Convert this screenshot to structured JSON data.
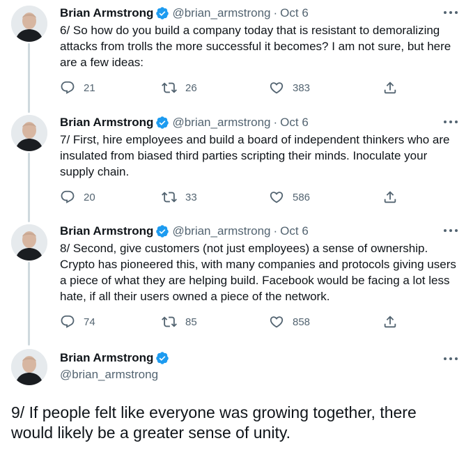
{
  "colors": {
    "verified": "#1d9bf0",
    "secondary_text": "#536471",
    "connector": "#cfd9de"
  },
  "tweets": [
    {
      "name": "Brian Armstrong",
      "handle": "@brian_armstrong",
      "separator": "·",
      "date": "Oct 6",
      "text": "6/ So how do you build a company today that is resistant to demoralizing attacks from trolls the more successful it becomes? I am not sure, but here are a few ideas:",
      "replies": "21",
      "retweets": "26",
      "likes": "383"
    },
    {
      "name": "Brian Armstrong",
      "handle": "@brian_armstrong",
      "separator": "·",
      "date": "Oct 6",
      "text": "7/ First, hire employees and build a board of independent thinkers who are insulated from biased third parties scripting their minds. Inoculate your supply chain.",
      "replies": "20",
      "retweets": "33",
      "likes": "586"
    },
    {
      "name": "Brian Armstrong",
      "handle": "@brian_armstrong",
      "separator": "·",
      "date": "Oct 6",
      "text": "8/ Second, give customers (not just employees) a sense of ownership. Crypto has pioneered this, with many companies and protocols giving users a piece of what they are helping build. Facebook would be facing a lot less hate, if all their users owned a piece of the network.",
      "replies": "74",
      "retweets": "85",
      "likes": "858"
    }
  ],
  "focused_tweet": {
    "name": "Brian Armstrong",
    "handle": "@brian_armstrong",
    "text": "9/ If people felt like everyone was growing together, there would likely be a greater sense of unity."
  },
  "icons": {
    "avatar": "avatar-photo",
    "verified": "verified-badge-icon",
    "more": "more-options-icon",
    "reply": "reply-icon",
    "retweet": "retweet-icon",
    "like": "heart-icon",
    "share": "share-icon"
  }
}
